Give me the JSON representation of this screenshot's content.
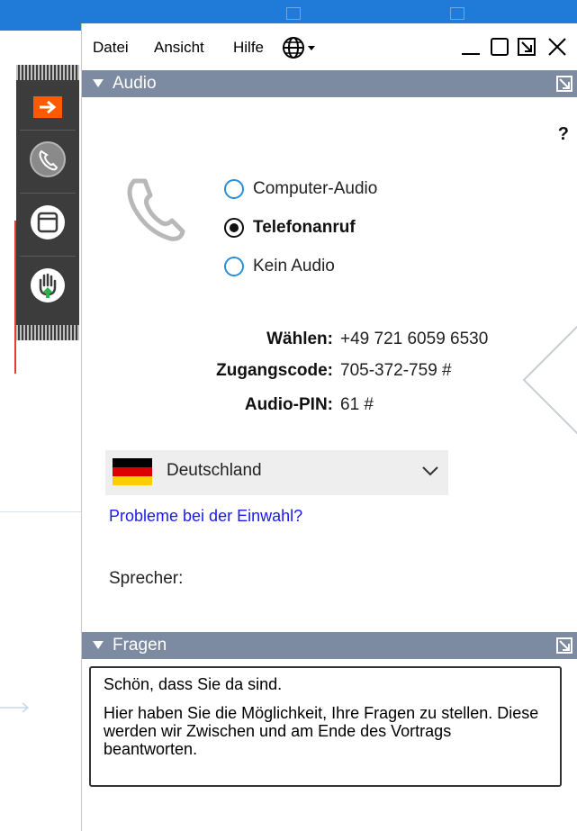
{
  "menu": {
    "file": "Datei",
    "view": "Ansicht",
    "help": "Hilfe"
  },
  "audio_panel": {
    "title": "Audio",
    "help_label": "?",
    "options": [
      {
        "label": "Computer-Audio",
        "selected": false
      },
      {
        "label": "Telefonanruf",
        "selected": true
      },
      {
        "label": "Kein Audio",
        "selected": false
      }
    ],
    "dial": {
      "label": "Wählen:",
      "value": "+49 721 6059 6530"
    },
    "access_code": {
      "label": "Zugangscode:",
      "value": "705-372-759 #"
    },
    "audio_pin": {
      "label": "Audio-PIN:",
      "value": "61 #"
    },
    "country": "Deutschland",
    "problems_link": "Probleme bei der Einwahl?",
    "speaker_label": "Sprecher:"
  },
  "questions_panel": {
    "title": "Fragen",
    "greeting": "Schön, dass Sie da sind.",
    "message": "Hier haben Sie die Möglichkeit, Ihre Fragen zu stellen. Diese werden wir Zwischen und am Ende des Vortrags beantworten."
  },
  "colors": {
    "panel_header": "#7c8aa2",
    "radio_accent": "#2b8fd6",
    "link": "#1a1aee",
    "control_bar": "#3c3c3c",
    "orange_button": "#ff5a00",
    "background_bar": "#1f7ad8"
  },
  "icons": [
    "globe-icon",
    "minimize-icon",
    "maximize-icon",
    "popout-icon",
    "close-icon",
    "arrow-right-icon",
    "phone-icon",
    "window-icon",
    "raise-hand-icon",
    "chevron-down-icon"
  ]
}
